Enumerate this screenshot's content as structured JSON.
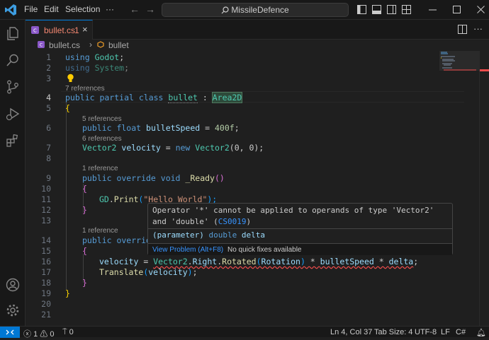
{
  "titlebar": {
    "menu": [
      "File",
      "Edit",
      "Selection",
      "···"
    ],
    "search": "MissileDefence"
  },
  "tab": {
    "name": "bullet.cs",
    "count": "1",
    "close": "×"
  },
  "breadcrumb": {
    "file": "bullet.cs",
    "sep": "›",
    "symbol": "bullet"
  },
  "lens": {
    "l4": "7 references",
    "l6": "5 references",
    "l7": "6 references",
    "l9": "1 reference",
    "l14": "1 reference"
  },
  "line_numbers": [
    "1",
    "2",
    "3",
    "4",
    "5",
    "6",
    "7",
    "8",
    "9",
    "10",
    "11",
    "12",
    "13",
    "14",
    "15",
    "16",
    "17",
    "18",
    "19",
    "20",
    "21"
  ],
  "code": {
    "l1_kw": "using",
    "l1_ns": "Godot",
    "l1_p": ";",
    "l2_kw": "using",
    "l2_ns": "System",
    "l2_p": ";",
    "l4_kw": "public partial class",
    "l4_cls": "bullet",
    "l4_colon": " : ",
    "l4_base": "Area2D",
    "l5": "{",
    "l6_kw": "public float",
    "l6_name": "bulletSpeed",
    "l6_eq": " = ",
    "l6_val": "400f",
    "l6_p": ";",
    "l7_ty": "Vector2",
    "l7_name": "velocity",
    "l7_eq": " = ",
    "l7_new": "new",
    "l7_ctor": "Vector2",
    "l7_args": "(0, 0);",
    "l9_kw": "public override void",
    "l9_fn": "_Ready",
    "l9_paren": "()",
    "l10": "{",
    "l11_cls": "GD",
    "l11_fn": "Print",
    "l11_o": "(",
    "l11_str": "\"Hello World\"",
    "l11_c": ");",
    "l12": "}",
    "l14_kw": "public override",
    "l15": "{",
    "l16_var": "velocity",
    "l16_eq": " = ",
    "l16_a": "Vector2",
    "l16_b": "Right",
    "l16_c": "Rotated",
    "l16_d": "Rotation",
    "l16_e": "bulletSpeed",
    "l16_f": "delta",
    "l17_fn": "Translate",
    "l17_var": "velocity",
    "l18": "}",
    "l19": "}"
  },
  "hover": {
    "message": "Operator '*' cannot be applied to operands of type 'Vector2' and 'double'",
    "code": "CS0019",
    "sig_kind": "(parameter)",
    "sig_type": "double",
    "sig_name": "delta",
    "view_problem": "View Problem (Alt+F8)",
    "no_fix": "No quick fixes available"
  },
  "status": {
    "errors": "1",
    "warnings": "0",
    "ports": "0",
    "position": "Ln 4, Col 37",
    "tabsize": "Tab Size: 4",
    "encoding": "UTF-8",
    "eol": "LF",
    "language": "C#"
  },
  "colors": {
    "accent": "#0078d4",
    "error": "#f14c4c"
  }
}
